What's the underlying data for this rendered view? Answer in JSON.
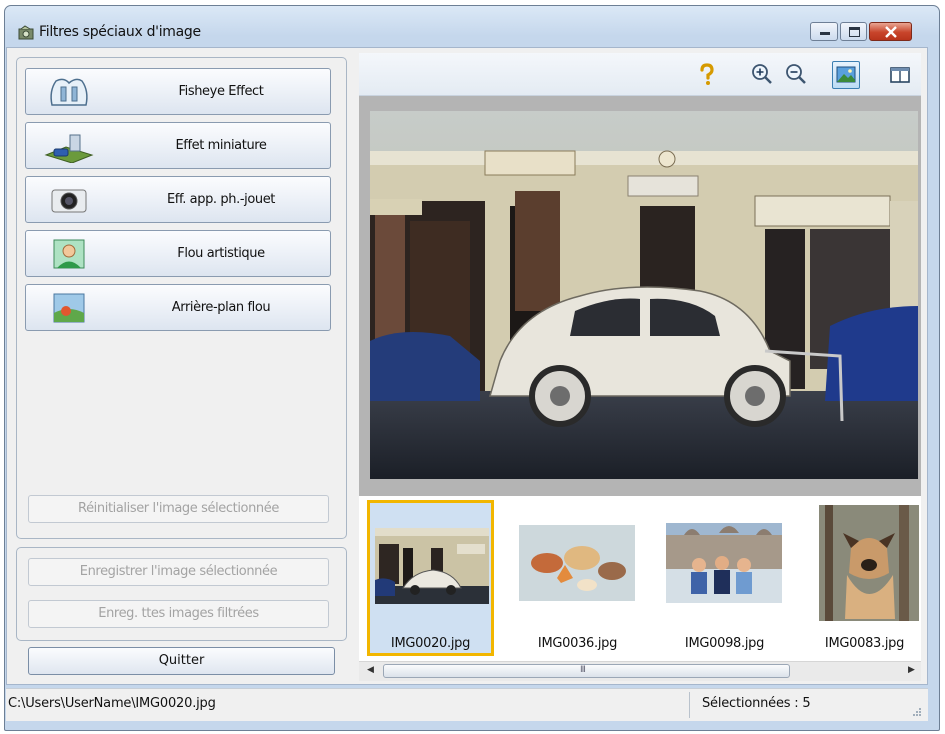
{
  "window": {
    "title": "Filtres spéciaux d'image",
    "controls": [
      "minimize-icon",
      "maximize-icon",
      "close-icon"
    ]
  },
  "filters": [
    {
      "label": "Fisheye Effect",
      "icon": "fisheye-icon"
    },
    {
      "label": "Effet miniature",
      "icon": "miniature-icon"
    },
    {
      "label": "Eff. app. ph.-jouet",
      "icon": "toy-camera-icon"
    },
    {
      "label": "Flou artistique",
      "icon": "portrait-icon"
    },
    {
      "label": "Arrière-plan flou",
      "icon": "blur-background-icon"
    }
  ],
  "actions": {
    "reset_label": "Réinitialiser l'image sélectionnée",
    "save_label": "Enregistrer l'image sélectionnée",
    "save_all_label": "Enreg. ttes images filtrées",
    "quit_label": "Quitter"
  },
  "toolbar": {
    "buttons": [
      "help-icon",
      "zoom-in-icon",
      "zoom-out-icon",
      "whole-image-view-icon",
      "compare-view-icon"
    ],
    "active": "whole-image-view-icon"
  },
  "thumbnails": [
    {
      "filename": "IMG0020.jpg",
      "selected": true
    },
    {
      "filename": "IMG0036.jpg",
      "selected": false
    },
    {
      "filename": "IMG0098.jpg",
      "selected": false
    },
    {
      "filename": "IMG0083.jpg",
      "selected": false
    }
  ],
  "scrollbar": {
    "grip": "III"
  },
  "status": {
    "path": "C:\\Users\\UserName\\IMG0020.jpg",
    "selected_count": "Sélectionnées : 5"
  },
  "colors": {
    "selection_border": "#f2b600",
    "titlebar": "#c5d7ec",
    "close_button": "#c8452b"
  }
}
